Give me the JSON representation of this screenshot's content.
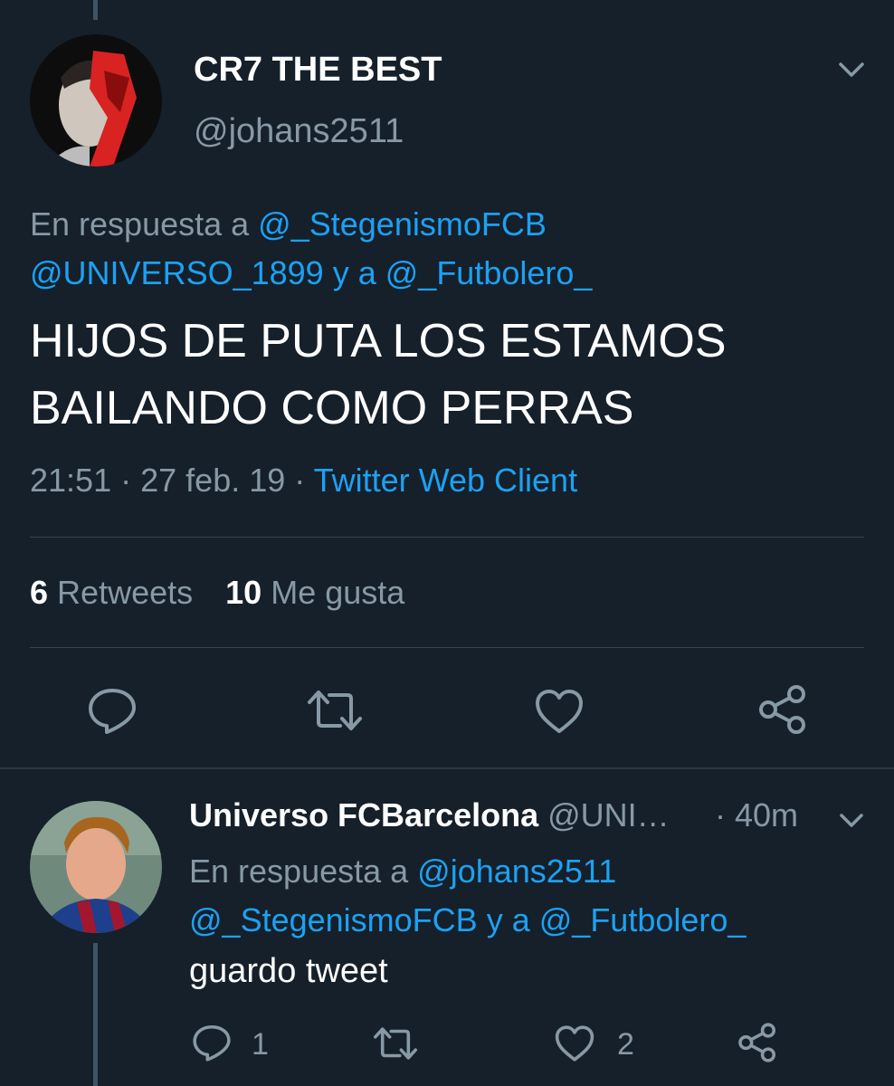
{
  "main_tweet": {
    "display_name": "CR7 THE BEST",
    "handle": "@johans2511",
    "reply_prefix": "En respuesta a",
    "reply_user1": "@_StegenismoFCB",
    "reply_user2": "@UNIVERSO_1899",
    "reply_and": "y a",
    "reply_user3": "@_Futbolero_",
    "text_line1": "HIJOS DE PUTA LOS ESTAMOS",
    "text_line2": "BAILANDO COMO PERRAS",
    "time": "21:51",
    "sep": "·",
    "date": "27 feb. 19",
    "source": "Twitter Web Client",
    "retweets_count": "6",
    "retweets_label": "Retweets",
    "likes_count": "10",
    "likes_label": "Me gusta"
  },
  "reply_tweet": {
    "display_name": "Universo FCBarcelona",
    "handle": "@UNI…",
    "age": "· 40m",
    "reply_prefix": "En respuesta a",
    "reply_user1": "@johans2511",
    "reply_user2": "@_StegenismoFCB",
    "reply_and": "y a",
    "reply_user3": "@_Futbolero_",
    "text": "guardo tweet",
    "reply_count": "1",
    "like_count": "2"
  },
  "colors": {
    "background": "#15202b",
    "accent": "#1da1f2",
    "muted": "#8899a6"
  }
}
